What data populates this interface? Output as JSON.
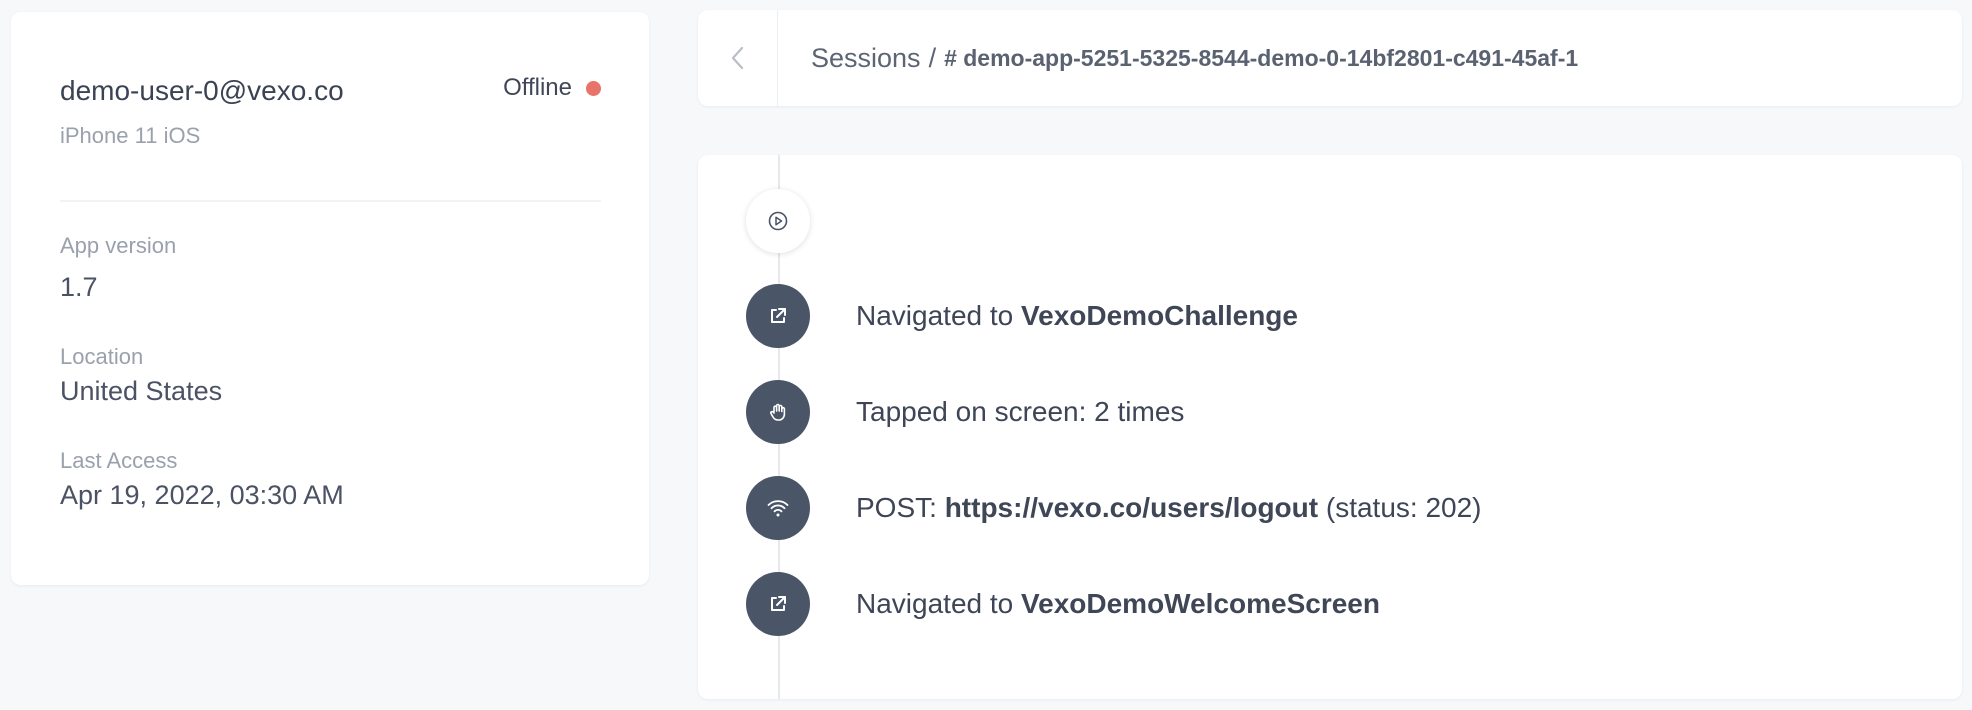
{
  "user": {
    "email": "demo-user-0@vexo.co",
    "device": "iPhone 11 iOS",
    "status": "Offline",
    "status_color": "#e8736b",
    "app_version_label": "App version",
    "app_version": "1.7",
    "location_label": "Location",
    "location": "United States",
    "last_access_label": "Last Access",
    "last_access": "Apr 19, 2022, 03:30 AM"
  },
  "header": {
    "back_icon": "chevron-left-icon",
    "breadcrumb_root": "Sessions",
    "separator": "/",
    "session_id": "# demo-app-5251-5325-8544-demo-0-14bf2801-c491-45af-1"
  },
  "timeline": {
    "start_icon": "play-circle-icon",
    "events": [
      {
        "icon": "external-link-icon",
        "prefix": "Navigated to ",
        "bold": "VexoDemoChallenge",
        "suffix": ""
      },
      {
        "icon": "hand-icon",
        "prefix": "Tapped on screen: 2 times",
        "bold": "",
        "suffix": ""
      },
      {
        "icon": "wifi-icon",
        "prefix": "POST: ",
        "bold": "https://vexo.co/users/logout",
        "suffix": " (status: 202)"
      },
      {
        "icon": "external-link-icon",
        "prefix": "Navigated to ",
        "bold": "VexoDemoWelcomeScreen",
        "suffix": ""
      }
    ]
  },
  "colors": {
    "background": "#f7f8fa",
    "card": "#ffffff",
    "icon_dark": "#4a5568",
    "text": "#3d4556",
    "muted": "#9aa1ad"
  }
}
